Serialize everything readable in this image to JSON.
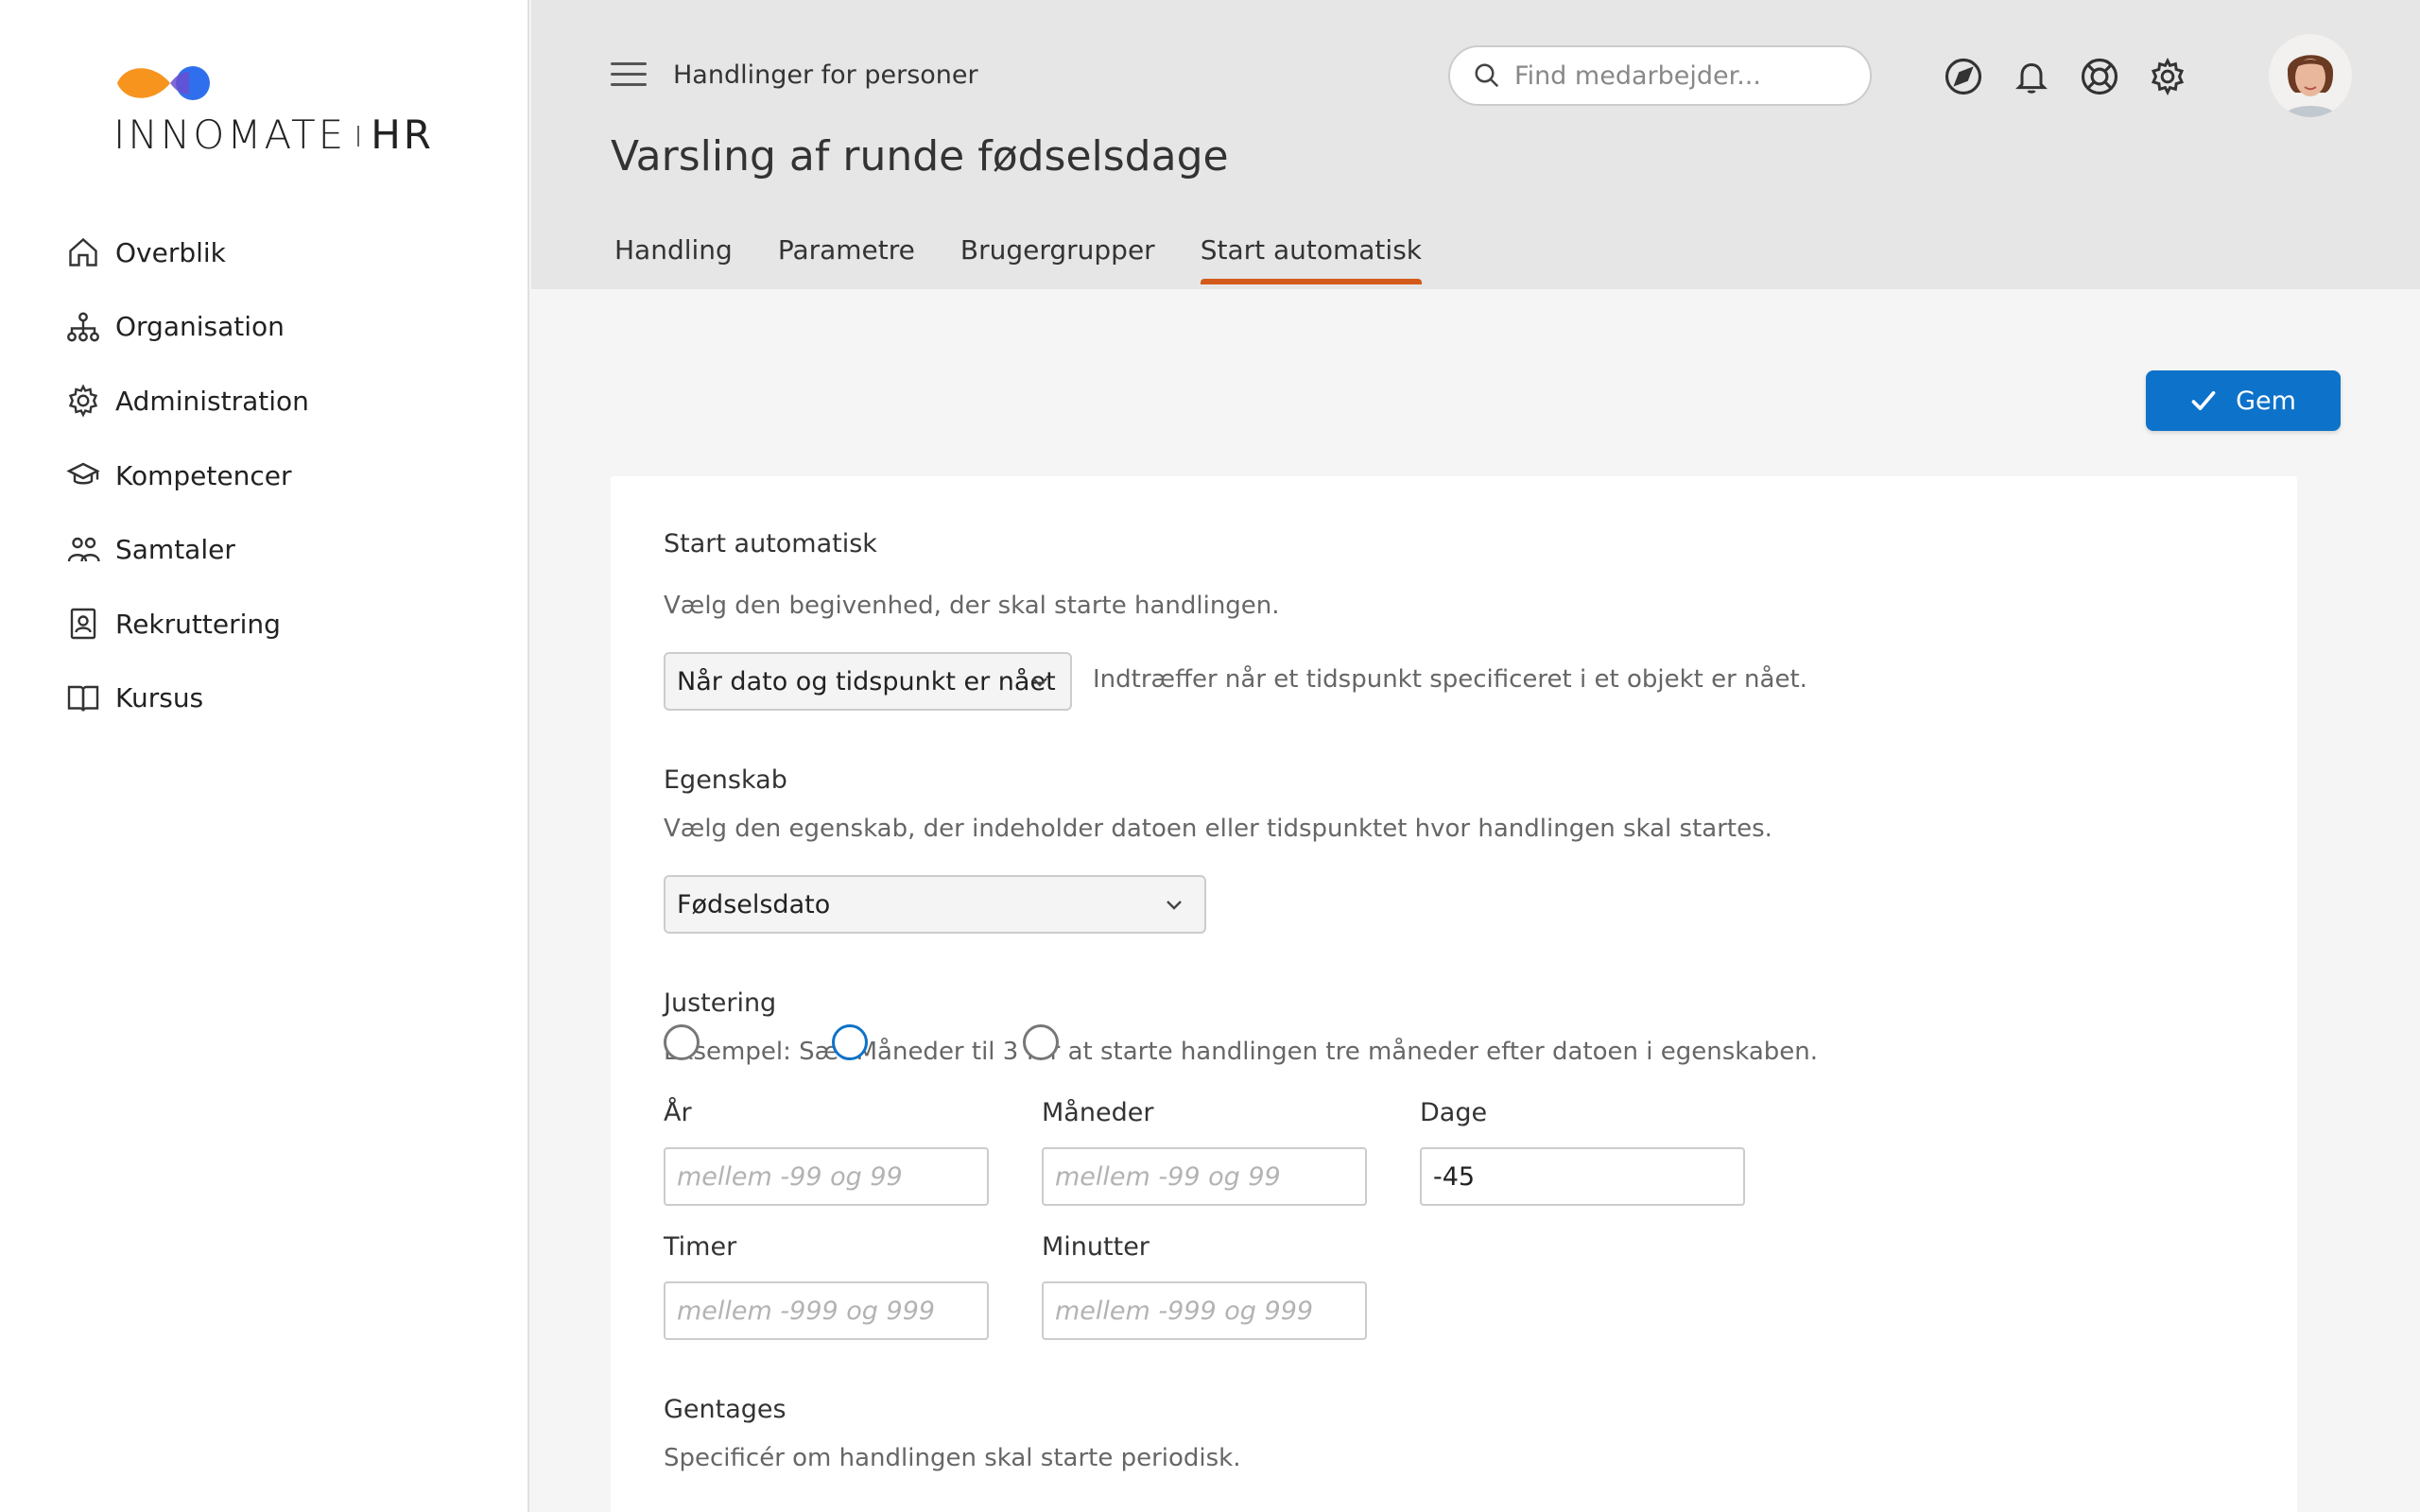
{
  "brand": {
    "name_part1": "INNOMATE",
    "name_part2": "HR",
    "colors": {
      "orange": "#f7941d",
      "blue": "#2f6fed"
    }
  },
  "sidebar": {
    "items": [
      {
        "label": "Overblik",
        "icon": "home-icon"
      },
      {
        "label": "Organisation",
        "icon": "org-chart-icon"
      },
      {
        "label": "Administration",
        "icon": "gear-icon"
      },
      {
        "label": "Kompetencer",
        "icon": "graduation-cap-icon"
      },
      {
        "label": "Samtaler",
        "icon": "people-icon"
      },
      {
        "label": "Rekruttering",
        "icon": "id-card-icon"
      },
      {
        "label": "Kursus",
        "icon": "book-icon"
      }
    ]
  },
  "header": {
    "breadcrumb": "Handlinger for personer",
    "title": "Varsling af runde fødselsdage",
    "search_placeholder": "Find medarbejder...",
    "tabs": [
      {
        "label": "Handling"
      },
      {
        "label": "Parametre"
      },
      {
        "label": "Brugergrupper"
      },
      {
        "label": "Start automatisk"
      }
    ],
    "active_tab": "Start automatisk",
    "icons": [
      "navigate-icon",
      "bell-icon",
      "lifebuoy-icon",
      "settings-icon"
    ]
  },
  "toolbar": {
    "save_label": "Gem",
    "save_color": "#0d72c9"
  },
  "form": {
    "start": {
      "heading": "Start automatisk",
      "help": "Vælg den begivenhed, der skal starte handlingen.",
      "selected": "Når dato og tidspunkt er nået",
      "description": "Indtræffer når et tidspunkt specificeret i et objekt er nået."
    },
    "property": {
      "heading": "Egenskab",
      "help": "Vælg den egenskab, der indeholder datoen eller tidspunktet hvor handlingen skal startes.",
      "selected": "Fødselsdato"
    },
    "adjust": {
      "heading": "Justering",
      "help": "Eksempel: Sæt Måneder til 3 for at starte handlingen tre måneder efter datoen i egenskaben.",
      "years": {
        "label": "År",
        "placeholder": "mellem -99 og 99",
        "value": ""
      },
      "months": {
        "label": "Måneder",
        "placeholder": "mellem -99 og 99",
        "value": ""
      },
      "days": {
        "label": "Dage",
        "placeholder": "mellem -99 og 99",
        "value": "-45"
      },
      "hours": {
        "label": "Timer",
        "placeholder": "mellem -999 og 999",
        "value": ""
      },
      "minutes": {
        "label": "Minutter",
        "placeholder": "mellem -999 og 999",
        "value": ""
      }
    },
    "repeat": {
      "heading": "Gentages",
      "help": "Specificér om handlingen skal starte periodisk."
    }
  },
  "tab_accent": "#d35a1b"
}
